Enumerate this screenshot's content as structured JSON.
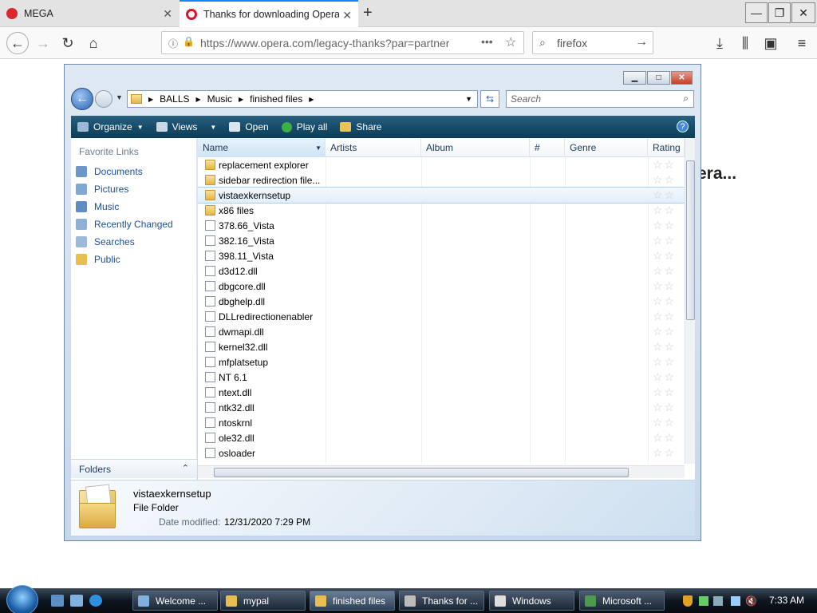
{
  "browser": {
    "tabs": [
      {
        "title": "MEGA",
        "icon": "mega-icon"
      },
      {
        "title": "Thanks for downloading Opera",
        "icon": "opera-icon"
      }
    ],
    "url": "https://www.opera.com/legacy-thanks?par=partner",
    "search": "firefox",
    "page_heading_partial": "era..."
  },
  "explorer": {
    "breadcrumb": [
      "BALLS",
      "Music",
      "finished files"
    ],
    "search_placeholder": "Search",
    "toolbar": {
      "organize": "Organize",
      "views": "Views",
      "open": "Open",
      "play_all": "Play all",
      "share": "Share"
    },
    "nav": {
      "favorite_links": "Favorite Links",
      "items": [
        "Documents",
        "Pictures",
        "Music",
        "Recently Changed",
        "Searches",
        "Public"
      ],
      "folders": "Folders"
    },
    "columns": [
      "Name",
      "Artists",
      "Album",
      "#",
      "Genre",
      "Rating"
    ],
    "files": [
      {
        "name": "replacement explorer",
        "type": "folder"
      },
      {
        "name": "sidebar redirection file...",
        "type": "folder"
      },
      {
        "name": "vistaexkernsetup",
        "type": "folder",
        "selected": true
      },
      {
        "name": "x86 files",
        "type": "folder"
      },
      {
        "name": "378.66_Vista",
        "type": "file"
      },
      {
        "name": "382.16_Vista",
        "type": "file"
      },
      {
        "name": "398.11_Vista",
        "type": "file"
      },
      {
        "name": "d3d12.dll",
        "type": "file"
      },
      {
        "name": "dbgcore.dll",
        "type": "file"
      },
      {
        "name": "dbghelp.dll",
        "type": "file"
      },
      {
        "name": "DLLredirectionenabler",
        "type": "file"
      },
      {
        "name": "dwmapi.dll",
        "type": "file"
      },
      {
        "name": "kernel32.dll",
        "type": "file"
      },
      {
        "name": "mfplatsetup",
        "type": "file"
      },
      {
        "name": "NT 6.1",
        "type": "file"
      },
      {
        "name": "ntext.dll",
        "type": "file"
      },
      {
        "name": "ntk32.dll",
        "type": "file"
      },
      {
        "name": "ntoskrnl",
        "type": "file"
      },
      {
        "name": "ole32.dll",
        "type": "file"
      },
      {
        "name": "osloader",
        "type": "file"
      }
    ],
    "rating_stars": "☆☆",
    "details": {
      "name": "vistaexkernsetup",
      "type": "File Folder",
      "date_label": "Date modified:",
      "date_value": "12/31/2020 7:29 PM"
    }
  },
  "taskbar": {
    "tasks": [
      "Welcome ...",
      "mypal",
      "finished files",
      "Thanks for ...",
      "Windows",
      "Microsoft ..."
    ],
    "active_task": "finished files",
    "clock": "7:33 AM"
  }
}
